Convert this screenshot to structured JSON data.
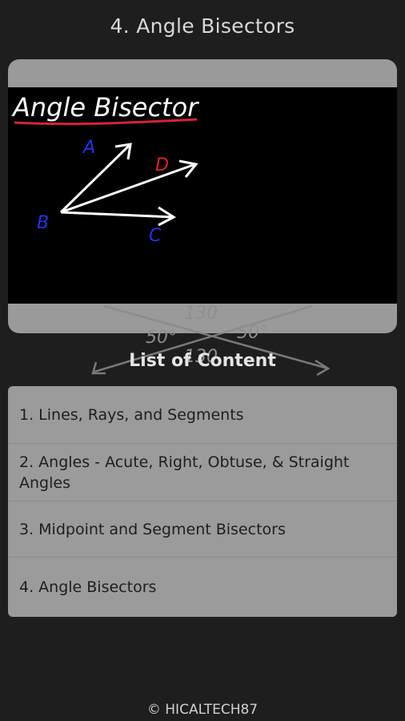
{
  "header": {
    "title": "4.  Angle Bisectors"
  },
  "video": {
    "whiteboard_title": "Angle Bisector",
    "point_a": "A",
    "point_b": "B",
    "point_c": "C",
    "point_d": "D"
  },
  "background_decoration": {
    "labels": [
      "130",
      "50°",
      "50°",
      "130"
    ]
  },
  "list": {
    "heading": "List of Content",
    "items": [
      {
        "label": "1.  Lines, Rays, and Segments"
      },
      {
        "label": "2.  Angles - Acute, Right, Obtuse, & Straight Angles"
      },
      {
        "label": "3.  Midpoint and Segment Bisectors"
      },
      {
        "label": "4.  Angle Bisectors"
      }
    ]
  },
  "footer": {
    "copyright": "© HICALTECH87"
  },
  "colors": {
    "background": "#1e1e1e",
    "card": "#9b9b9b",
    "video": "#000000",
    "underline": "#d8213a",
    "label_blue": "#2233ee",
    "label_red": "#e0202a"
  }
}
